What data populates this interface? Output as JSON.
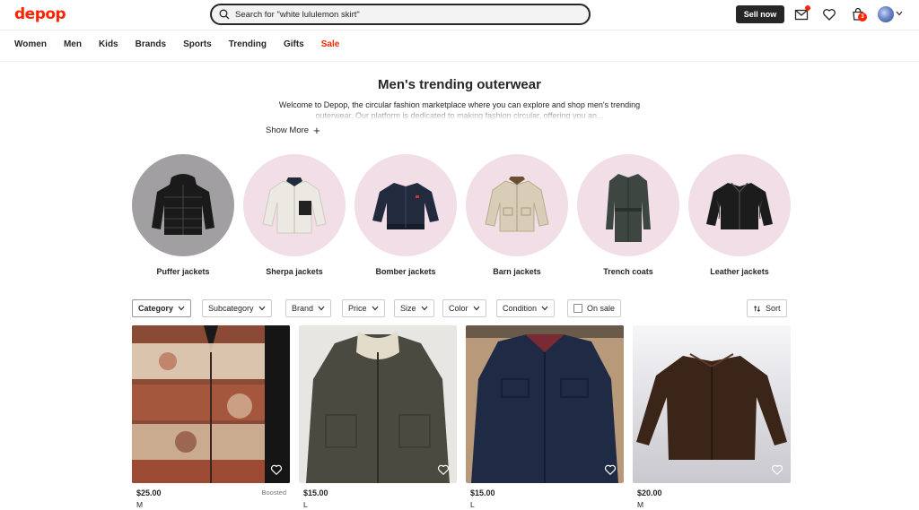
{
  "brand": {
    "logo_text": "depop",
    "accent": "#ff2300"
  },
  "search": {
    "placeholder": "Search for \"white lululemon skirt\""
  },
  "header": {
    "sell_label": "Sell now",
    "cart_count": "3"
  },
  "nav": [
    "Women",
    "Men",
    "Kids",
    "Brands",
    "Sports",
    "Trending",
    "Gifts",
    "Sale"
  ],
  "hero": {
    "title": "Men's trending outerwear",
    "intro": "Welcome to Depop, the circular fashion marketplace where you can explore and shop men's trending outerwear. Our platform is dedicated to making fashion circular, offering you an...",
    "show_more": "Show More"
  },
  "categories": [
    {
      "label": "Puffer jackets",
      "bg": "#a19fa1"
    },
    {
      "label": "Sherpa jackets",
      "bg": "#f1dee6"
    },
    {
      "label": "Bomber jackets",
      "bg": "#f1dee6"
    },
    {
      "label": "Barn jackets",
      "bg": "#f1dee6"
    },
    {
      "label": "Trench coats",
      "bg": "#f1dee6"
    },
    {
      "label": "Leather jackets",
      "bg": "#f1dee6"
    }
  ],
  "filters": [
    "Category",
    "Subcategory",
    "Brand",
    "Price",
    "Size",
    "Color",
    "Condition",
    "On sale"
  ],
  "sort_label": "Sort",
  "products": [
    {
      "price": "$25.00",
      "size": "M",
      "boosted": "Boosted"
    },
    {
      "price": "$15.00",
      "size": "L"
    },
    {
      "price": "$15.00",
      "size": "L"
    },
    {
      "price": "$20.00",
      "size": "M"
    }
  ]
}
